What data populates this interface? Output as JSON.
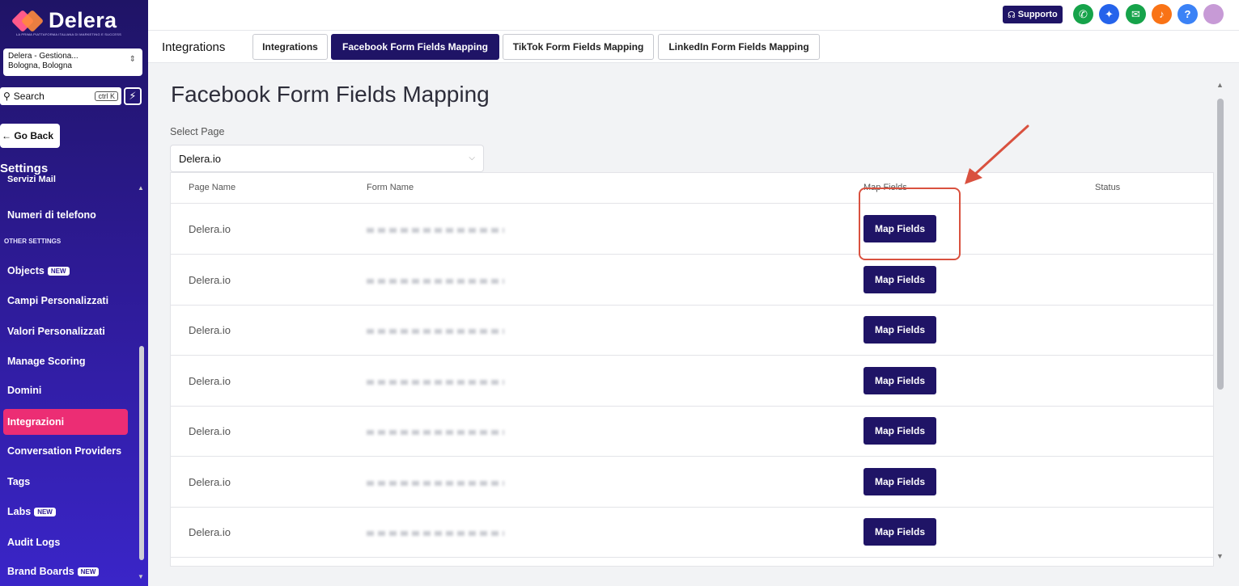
{
  "brand": {
    "name": "Delera",
    "tagline": "LA PRIMA PIATTAFORMA ITALIANA DI MARKETING E SUCCESS"
  },
  "account": {
    "name": "Delera - Gestiona...",
    "location": "Bologna, Bologna"
  },
  "search": {
    "placeholder": "Search",
    "shortcut": "ctrl K"
  },
  "sidebar": {
    "go_back": "← Go Back",
    "settings_title": "Settings",
    "partial_item": "Servizi Mail",
    "section_other": "OTHER SETTINGS",
    "items": [
      {
        "label": "Numeri di telefono",
        "badge": ""
      },
      {
        "label": "Objects",
        "badge": "NEW"
      },
      {
        "label": "Campi Personalizzati",
        "badge": ""
      },
      {
        "label": "Valori Personalizzati",
        "badge": ""
      },
      {
        "label": "Manage Scoring",
        "badge": ""
      },
      {
        "label": "Domini",
        "badge": ""
      },
      {
        "label": "Integrazioni",
        "badge": "",
        "active": true
      },
      {
        "label": "Conversation Providers",
        "badge": ""
      },
      {
        "label": "Tags",
        "badge": ""
      },
      {
        "label": "Labs",
        "badge": "NEW"
      },
      {
        "label": "Audit Logs",
        "badge": ""
      },
      {
        "label": "Brand Boards",
        "badge": "NEW"
      }
    ]
  },
  "topbar": {
    "support_label": "Supporto",
    "icons": [
      "phone-icon",
      "sparkle-icon",
      "megaphone-icon",
      "bell-icon",
      "help-icon",
      "avatar"
    ],
    "colors": {
      "support": "#1f1466",
      "phone": "#16a34a",
      "sparkle": "#2563eb",
      "megaphone": "#16a34a",
      "bell": "#f97316",
      "help": "#3b82f6"
    }
  },
  "subnav": {
    "title": "Integrations",
    "tabs": [
      {
        "label": "Integrations",
        "active": false
      },
      {
        "label": "Facebook Form Fields Mapping",
        "active": true
      },
      {
        "label": "TikTok Form Fields Mapping",
        "active": false
      },
      {
        "label": "LinkedIn Form Fields Mapping",
        "active": false
      }
    ]
  },
  "main": {
    "title": "Facebook Form Fields Mapping",
    "select_label": "Select Page",
    "select_value": "Delera.io",
    "columns": [
      "Page Name",
      "Form Name",
      "Map Fields",
      "Status"
    ],
    "rows": [
      {
        "page": "Delera.io",
        "form": "",
        "action": "Map Fields",
        "status": ""
      },
      {
        "page": "Delera.io",
        "form": "",
        "action": "Map Fields",
        "status": ""
      },
      {
        "page": "Delera.io",
        "form": "",
        "action": "Map Fields",
        "status": ""
      },
      {
        "page": "Delera.io",
        "form": "",
        "action": "Map Fields",
        "status": ""
      },
      {
        "page": "Delera.io",
        "form": "",
        "action": "Map Fields",
        "status": ""
      },
      {
        "page": "Delera.io",
        "form": "",
        "action": "Map Fields",
        "status": ""
      },
      {
        "page": "Delera.io",
        "form": "",
        "action": "Map Fields",
        "status": ""
      }
    ]
  },
  "colors": {
    "primary": "#1f1466",
    "active_nav": "#ec2d74",
    "annotation": "#d9513f"
  }
}
